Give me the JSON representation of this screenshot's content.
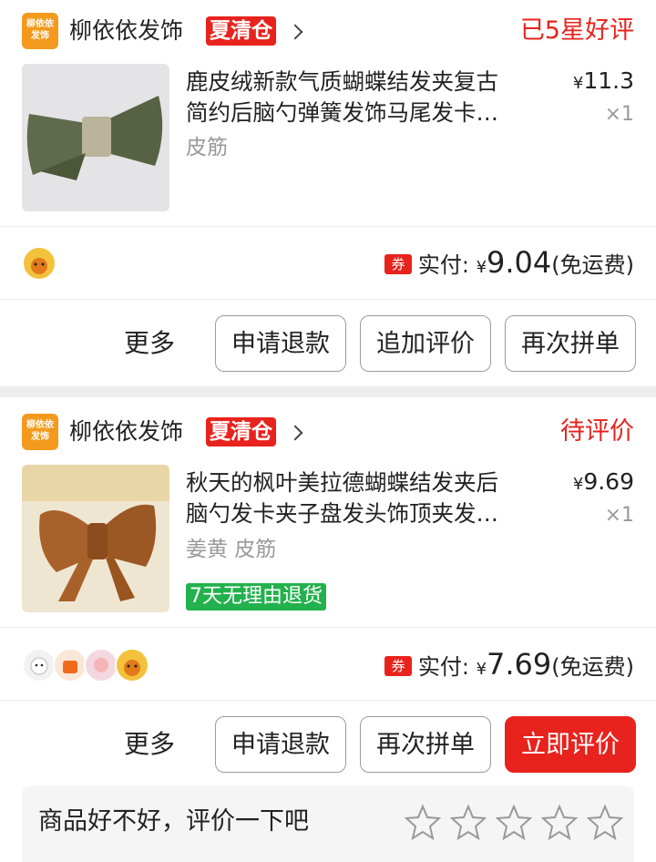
{
  "orders": [
    {
      "shop": {
        "logo_text": "柳依依发饰",
        "name": "柳依依发饰",
        "promo_tag": "夏清仓"
      },
      "status": "已5星好评",
      "item": {
        "title_line1": "鹿皮绒新款气质蝴蝶结发夹复古",
        "title_line2": "简约后脑勺弹簧发饰马尾发卡…",
        "spec": "皮筋",
        "price_symbol": "¥",
        "price": "11.3",
        "qty": "×1"
      },
      "coupon": "券",
      "paid_label": "实付:",
      "paid_symbol": "¥",
      "paid_amount": "9.04",
      "shipping": "(免运费)",
      "actions": {
        "more": "更多",
        "btn1": "申请退款",
        "btn2": "追加评价",
        "btn3": "再次拼单"
      }
    },
    {
      "shop": {
        "logo_text": "柳依依发饰",
        "name": "柳依依发饰",
        "promo_tag": "夏清仓"
      },
      "status": "待评价",
      "item": {
        "title_line1": "秋天的枫叶美拉德蝴蝶结发夹后",
        "title_line2": "脑勺发卡夹子盘发头饰顶夹发…",
        "spec": "姜黄 皮筋",
        "price_symbol": "¥",
        "price": "9.69",
        "qty": "×1",
        "return_tag": "7天无理由退货"
      },
      "coupon": "券",
      "paid_label": "实付:",
      "paid_symbol": "¥",
      "paid_amount": "7.69",
      "shipping": "(免运费)",
      "actions": {
        "more": "更多",
        "btn1": "申请退款",
        "btn2": "再次拼单",
        "btn3": "立即评价"
      },
      "review_prompt": "商品好不好，评价一下吧"
    }
  ],
  "colors": {
    "accent": "#e8231d",
    "green": "#23b14d",
    "shop_logo": "#f39a1e"
  }
}
